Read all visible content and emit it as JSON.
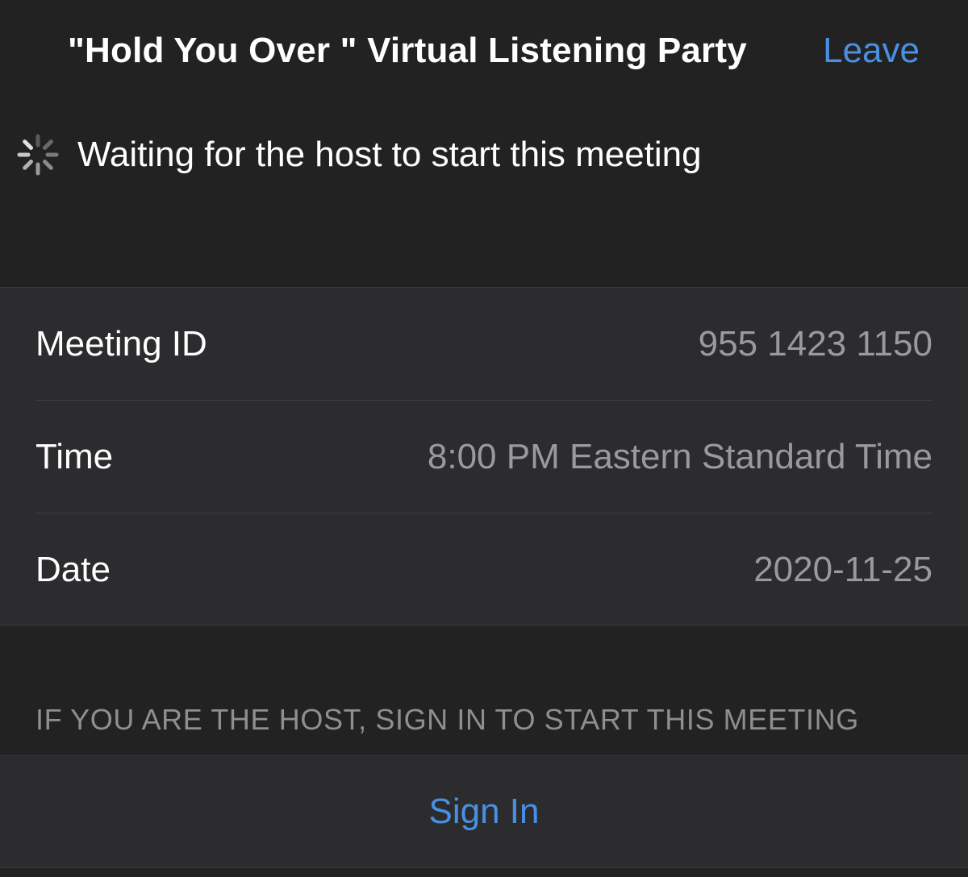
{
  "header": {
    "title": "\"Hold You Over \" Virtual Listening Party",
    "leave_label": "Leave"
  },
  "status": {
    "icon": "loading-spinner-icon",
    "text": "Waiting for the host to start this meeting"
  },
  "meeting_info": {
    "rows": [
      {
        "label": "Meeting ID",
        "value": "955 1423 1150"
      },
      {
        "label": "Time",
        "value": "8:00 PM Eastern Standard Time"
      },
      {
        "label": "Date",
        "value": "2020-11-25"
      }
    ]
  },
  "host_note": "IF YOU ARE THE HOST, SIGN IN TO START THIS MEETING",
  "sign_in": {
    "label": "Sign In"
  },
  "colors": {
    "background": "#222222",
    "group_background": "#2c2c2e",
    "accent": "#4a90e2",
    "secondary_text": "#9a9a9e"
  }
}
